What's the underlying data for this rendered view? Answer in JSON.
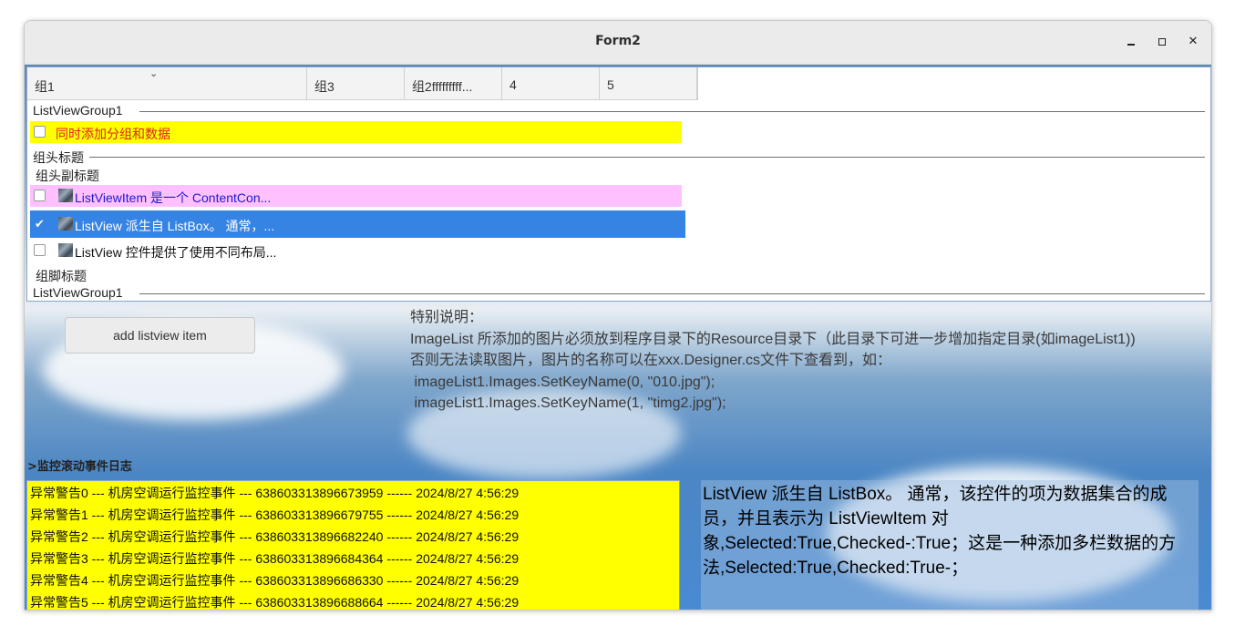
{
  "window": {
    "title": "Form2"
  },
  "listview": {
    "columns": [
      "组1",
      "组3",
      "组2fffffffff...",
      "4",
      "5"
    ],
    "group1_header": "ListViewGroup1",
    "item0": "同时添加分组和数据",
    "group2_header": "组头标题",
    "group2_subtitle": "组头副标题",
    "item1": "ListViewItem 是一个 ContentCon...",
    "item2": "ListView 派生自 ListBox。 通常，...",
    "item3": "ListView 控件提供了使用不同布局...",
    "group2_footer": "组脚标题",
    "group3_header": "ListViewGroup1"
  },
  "add_button": {
    "label": "add listview item"
  },
  "note": {
    "lines": [
      "特别说明：",
      "ImageList 所添加的图片必须放到程序目录下的Resource目录下（此目录下可进一步增加指定目录(如imageList1))",
      "否则无法读取图片，图片的名称可以在xxx.Designer.cs文件下查看到，如：",
      " imageList1.Images.SetKeyName(0, \"010.jpg\");",
      " imageList1.Images.SetKeyName(1, \"timg2.jpg\");"
    ]
  },
  "log": {
    "title": ">监控滚动事件日志",
    "entries": [
      "异常警告0 --- 机房空调运行监控事件 --- 638603313896673959 ------ 2024/8/27 4:56:29",
      "异常警告1 --- 机房空调运行监控事件 --- 638603313896679755 ------ 2024/8/27 4:56:29",
      "异常警告2 --- 机房空调运行监控事件 --- 638603313896682240 ------ 2024/8/27 4:56:29",
      "异常警告3 --- 机房空调运行监控事件 --- 638603313896684364 ------ 2024/8/27 4:56:29",
      "异常警告4 --- 机房空调运行监控事件 --- 638603313896686330 ------ 2024/8/27 4:56:29",
      "异常警告5 --- 机房空调运行监控事件 --- 638603313896688664 ------ 2024/8/27 4:56:29"
    ]
  },
  "description": {
    "text": "ListView 派生自 ListBox。 通常，该控件的项为数据集合的成员，并且表示为 ListViewItem 对象,Selected:True,Checked-:True；这是一种添加多栏数据的方法,Selected:True,Checked:True-；"
  },
  "colors": {
    "item0_bg": "#ffff00",
    "item0_text": "#e02020",
    "item1_bg": "#ffc0ff",
    "item1_text": "#1a1ad0",
    "selected_bg": "#3584e4",
    "log_bg": "#ffff00"
  }
}
